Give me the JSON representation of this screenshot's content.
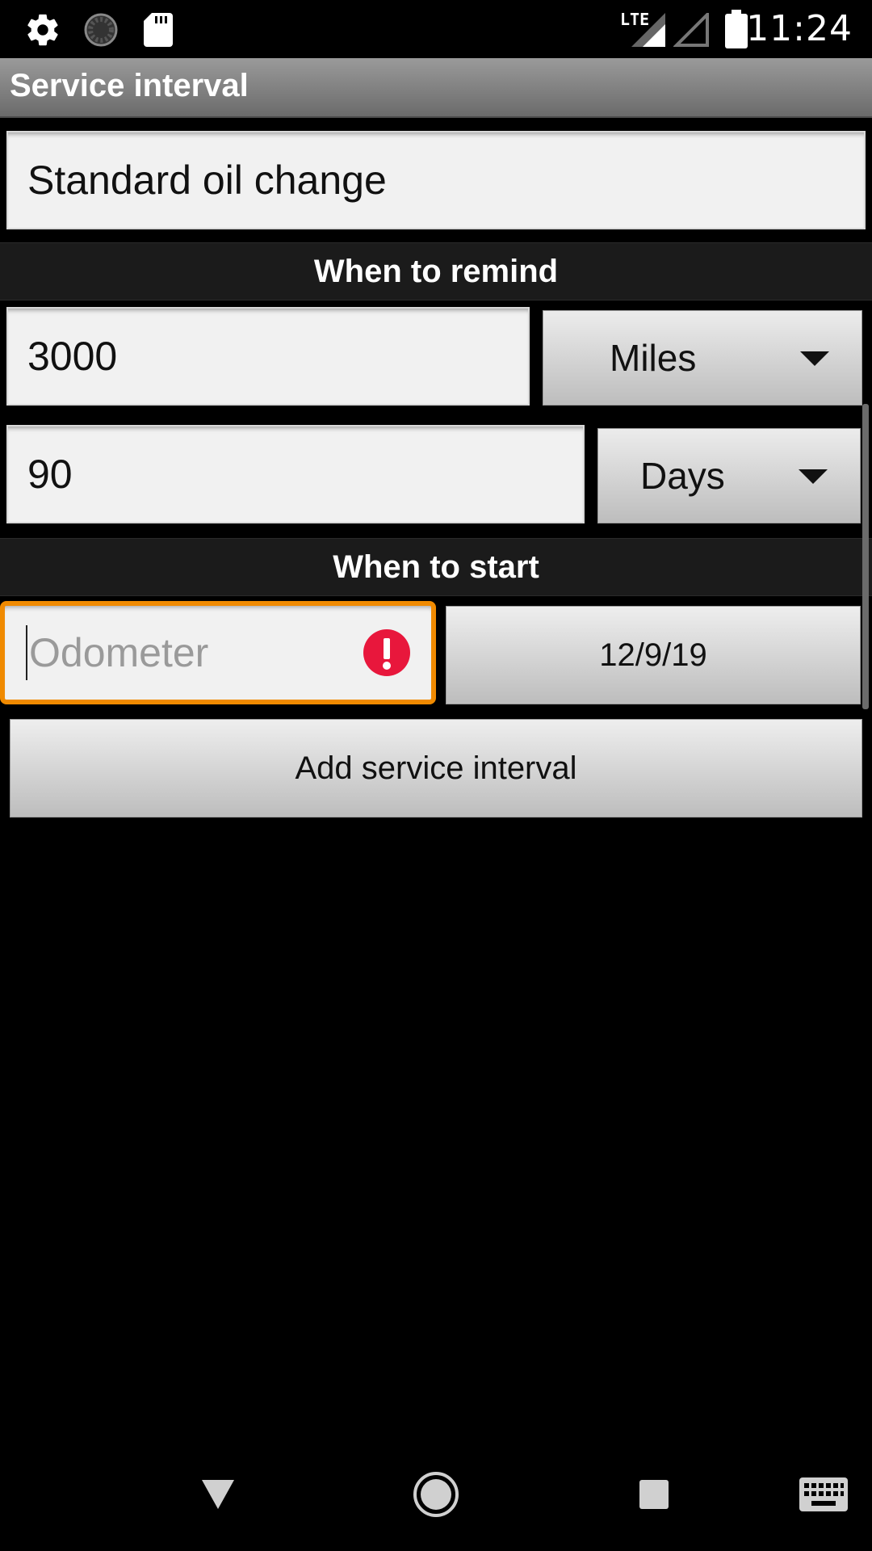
{
  "status_bar": {
    "time": "11:24",
    "network": "LTE",
    "icons": [
      "settings-icon",
      "sync-icon",
      "sd-card-icon",
      "lte-signal-icon",
      "signal-icon",
      "battery-icon"
    ]
  },
  "title_bar": {
    "title": "Service interval"
  },
  "form": {
    "name_value": "Standard oil change",
    "section_remind": "When to remind",
    "distance_value": "3000",
    "distance_unit": "Miles",
    "time_value": "90",
    "time_unit": "Days",
    "section_start": "When to start",
    "odometer_placeholder": "Odometer",
    "odometer_error": true,
    "start_date": "12/9/19",
    "add_button": "Add service interval"
  },
  "colors": {
    "focus_border": "#f08a00",
    "error": "#e8173c",
    "section_bg": "#1b1b1b"
  },
  "nav_bar": {
    "icons": [
      "back-icon",
      "home-icon",
      "recents-icon",
      "keyboard-icon"
    ]
  }
}
